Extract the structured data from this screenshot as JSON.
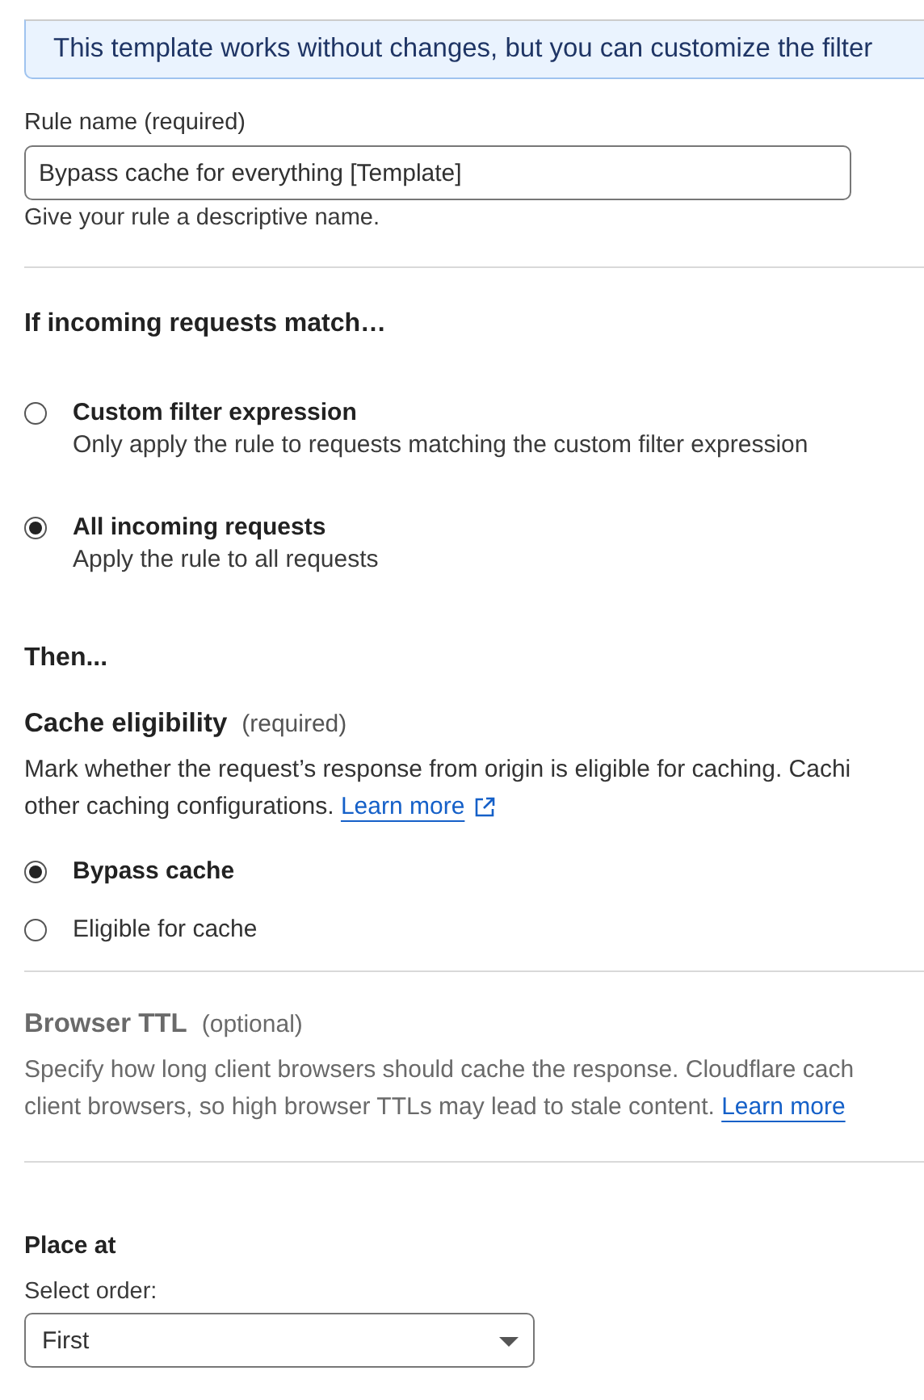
{
  "banner": {
    "text": "This template works without changes, but you can customize the filter"
  },
  "rule_name": {
    "label": "Rule name (required)",
    "value": "Bypass cache for everything [Template]",
    "help": "Give your rule a descriptive name."
  },
  "match": {
    "heading": "If incoming requests match…",
    "options": [
      {
        "label": "Custom filter expression",
        "description": "Only apply the rule to requests matching the custom filter expression",
        "selected": false
      },
      {
        "label": "All incoming requests",
        "description": "Apply the rule to all requests",
        "selected": true
      }
    ]
  },
  "then": {
    "heading": "Then..."
  },
  "cache_eligibility": {
    "title": "Cache eligibility",
    "note": "(required)",
    "disabled": false,
    "lines": [
      "Mark whether the request’s response from origin is eligible for caching. Cachi",
      "other caching configurations."
    ],
    "link": "Learn more",
    "options": [
      {
        "label": "Bypass cache",
        "selected": true
      },
      {
        "label": "Eligible for cache",
        "selected": false
      }
    ]
  },
  "browser_ttl": {
    "title": "Browser TTL",
    "note": "(optional)",
    "disabled": true,
    "lines": [
      "Specify how long client browsers should cache the response. Cloudflare cach",
      "client browsers, so high browser TTLs may lead to stale content."
    ],
    "link": "Learn more"
  },
  "place_at": {
    "heading": "Place at",
    "label": "Select order:",
    "value": "First"
  }
}
